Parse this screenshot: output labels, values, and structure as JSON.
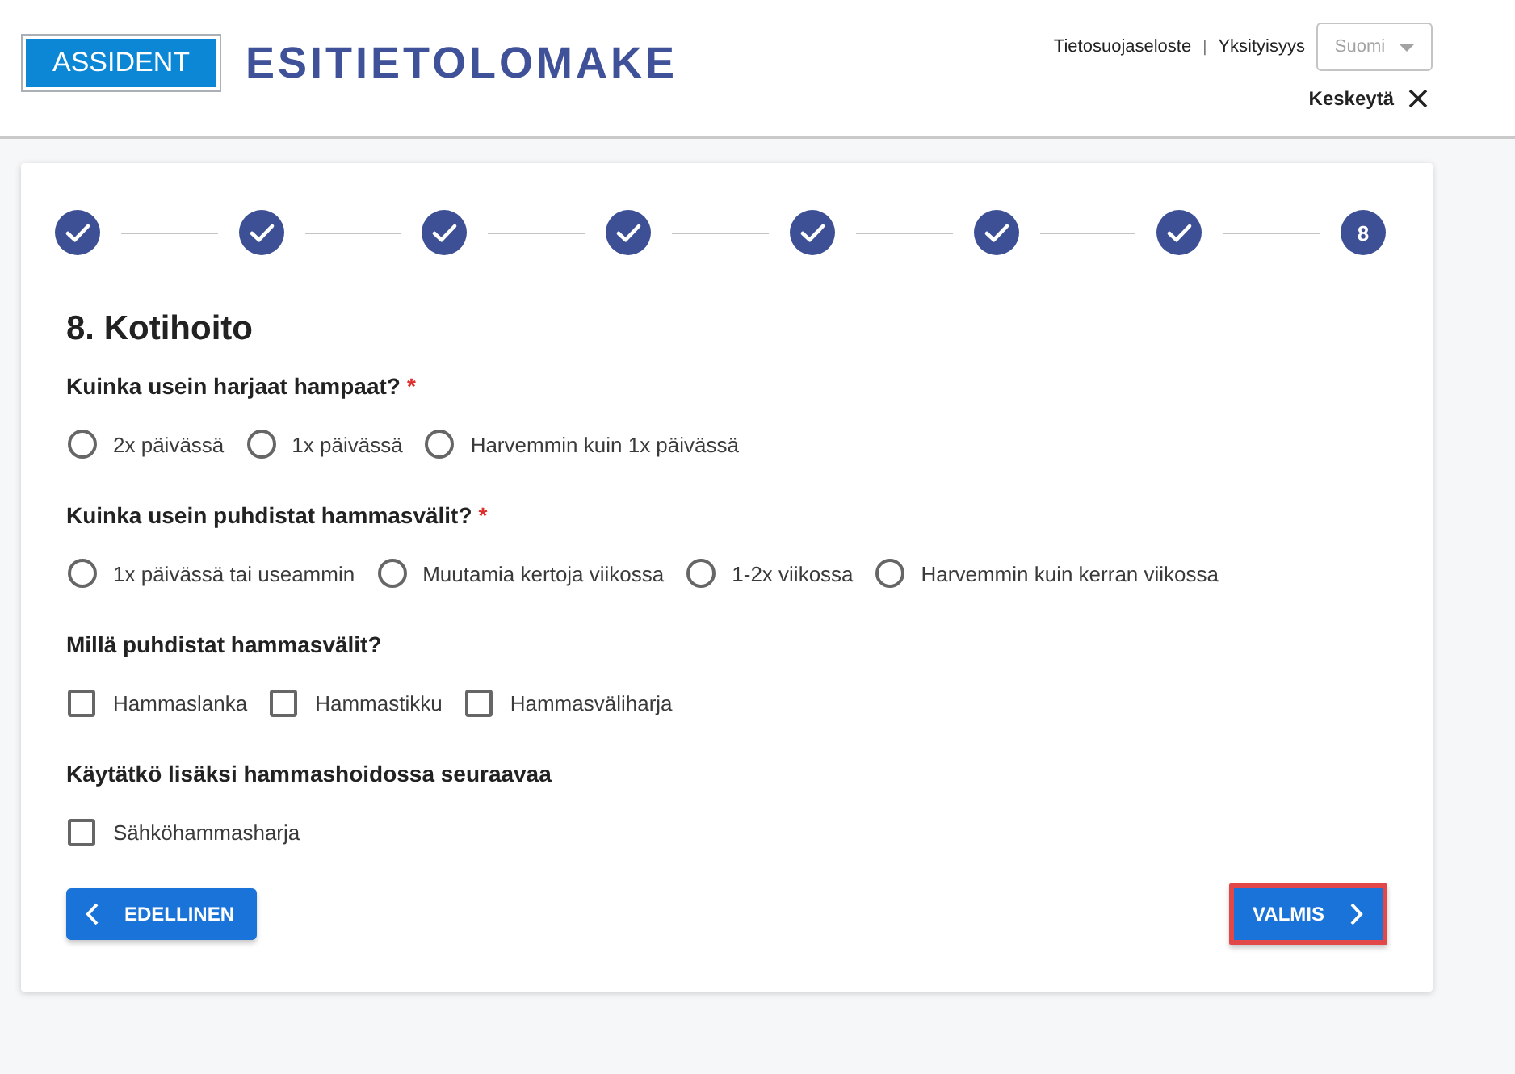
{
  "header": {
    "logo": "ASSIDENT",
    "title": "ESITIETOLOMAKE",
    "links": [
      {
        "label": "Tietosuojaseloste"
      },
      {
        "label": "Yksityisyys"
      }
    ],
    "link_separator": "|",
    "language_select": {
      "value": "Suomi",
      "disabled": true
    },
    "cancel": {
      "label": "Keskeytä"
    }
  },
  "stepper": {
    "steps": [
      {
        "completed": true
      },
      {
        "completed": true
      },
      {
        "completed": true
      },
      {
        "completed": true
      },
      {
        "completed": true
      },
      {
        "completed": true
      },
      {
        "completed": true
      },
      {
        "completed": false,
        "number": "8"
      }
    ]
  },
  "section": {
    "title": "8. Kotihoito",
    "questions": [
      {
        "kind": "radio",
        "text": "Kuinka usein harjaat hampaat?",
        "required_mark": "*",
        "options": [
          {
            "label": "2x päivässä",
            "selected": false
          },
          {
            "label": "1x päivässä",
            "selected": false
          },
          {
            "label": "Harvemmin kuin 1x päivässä",
            "selected": false
          }
        ]
      },
      {
        "kind": "radio",
        "text": "Kuinka usein puhdistat hammasvälit?",
        "required_mark": "*",
        "options": [
          {
            "label": "1x päivässä tai useammin",
            "selected": false
          },
          {
            "label": "Muutamia kertoja viikossa",
            "selected": false
          },
          {
            "label": "1-2x viikossa",
            "selected": false
          },
          {
            "label": "Harvemmin kuin kerran viikossa",
            "selected": false
          }
        ]
      },
      {
        "kind": "checkbox",
        "text": "Millä puhdistat hammasvälit?",
        "options": [
          {
            "label": "Hammaslanka",
            "checked": false
          },
          {
            "label": "Hammastikku",
            "checked": false
          },
          {
            "label": "Hammasväliharja",
            "checked": false
          }
        ]
      },
      {
        "kind": "checkbox",
        "text": "Käytätkö lisäksi hammashoidossa seuraavaa",
        "options": [
          {
            "label": "Sähköhammasharja",
            "checked": false
          }
        ]
      }
    ]
  },
  "navigation": {
    "back": {
      "label": "EDELLINEN"
    },
    "next": {
      "label": "VALMIS",
      "highlighted": true
    }
  }
}
